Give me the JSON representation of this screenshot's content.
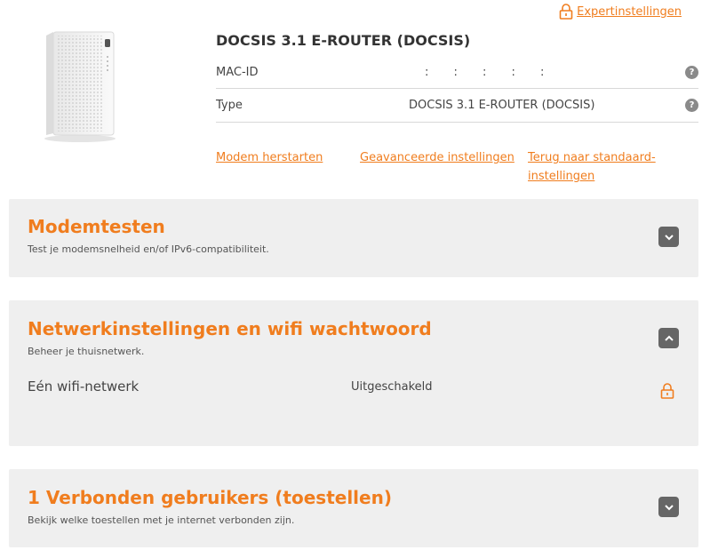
{
  "header": {
    "expert_link": "Expertinstellingen"
  },
  "device": {
    "title": "DOCSIS 3.1 E-ROUTER (DOCSIS)",
    "rows": [
      {
        "label": "MAC-ID",
        "value": ": : : : :"
      },
      {
        "label": "Type",
        "value": "DOCSIS 3.1 E-ROUTER (DOCSIS)"
      }
    ],
    "help_glyph": "?"
  },
  "actions": {
    "restart": "Modem herstarten",
    "advanced": "Geavanceerde instellingen",
    "reset_line1": "Terug naar standaard-",
    "reset_line2": "instellingen"
  },
  "panels": {
    "modemtests": {
      "title": "Modemtesten",
      "subtitle": "Test je modemsnelheid en/of IPv6-compatibiliteit."
    },
    "network": {
      "title": "Netwerkinstellingen en wifi wachtwoord",
      "subtitle": "Beheer je thuisnetwerk.",
      "wifi_label": "Eén wifi-netwerk",
      "wifi_status": "Uitgeschakeld"
    },
    "users": {
      "title": "1 Verbonden gebruikers (toestellen)",
      "subtitle": "Bekijk welke toestellen met je internet verbonden zijn."
    }
  },
  "colors": {
    "accent": "#f07d1e",
    "panel_bg": "#efefef",
    "toggle_bg": "#666666"
  },
  "icons": {
    "expert": "lock-icon",
    "help": "help-icon",
    "chevron_down": "chevron-down-icon",
    "chevron_up": "chevron-up-icon"
  }
}
